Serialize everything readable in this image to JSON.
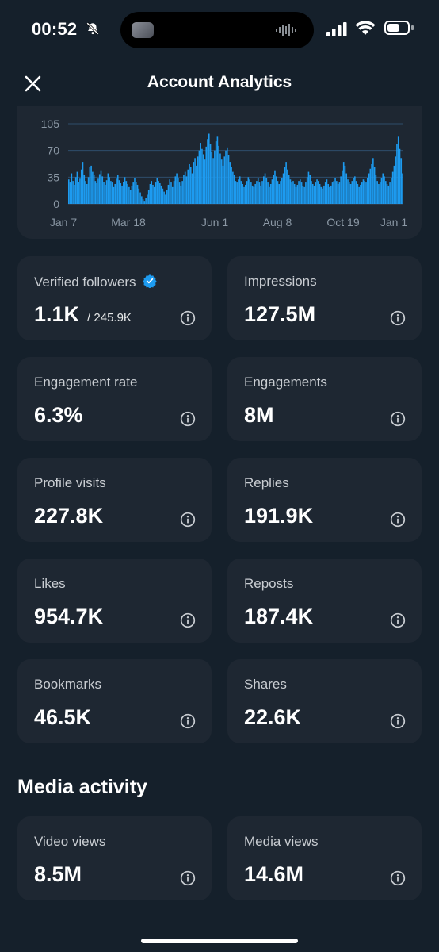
{
  "status_bar": {
    "time": "00:52"
  },
  "header": {
    "title": "Account Analytics"
  },
  "chart_data": {
    "type": "bar",
    "yticks": [
      105,
      70,
      35,
      0
    ],
    "ylim": [
      0,
      105
    ],
    "xticks": [
      "Jan 7",
      "Mar 18",
      "Jun 1",
      "Aug 8",
      "Oct 19",
      "Jan 1"
    ],
    "grid": true,
    "color": "#1d9bf0",
    "values": [
      32,
      28,
      40,
      30,
      25,
      35,
      42,
      29,
      33,
      45,
      55,
      38,
      30,
      26,
      35,
      48,
      50,
      42,
      38,
      30,
      27,
      33,
      39,
      44,
      36,
      29,
      25,
      31,
      40,
      35,
      30,
      28,
      22,
      26,
      33,
      38,
      31,
      27,
      24,
      29,
      35,
      30,
      26,
      22,
      18,
      24,
      28,
      34,
      29,
      25,
      20,
      15,
      10,
      6,
      4,
      8,
      12,
      18,
      26,
      30,
      25,
      22,
      28,
      34,
      30,
      27,
      24,
      20,
      16,
      12,
      18,
      25,
      32,
      28,
      22,
      30,
      36,
      40,
      34,
      28,
      24,
      30,
      38,
      42,
      36,
      45,
      52,
      48,
      40,
      55,
      60,
      50,
      62,
      70,
      80,
      72,
      65,
      58,
      75,
      85,
      92,
      78,
      68,
      60,
      70,
      82,
      88,
      76,
      66,
      58,
      50,
      62,
      70,
      74,
      64,
      55,
      48,
      42,
      38,
      30,
      28,
      32,
      36,
      30,
      26,
      22,
      25,
      30,
      35,
      32,
      28,
      24,
      22,
      26,
      30,
      34,
      28,
      24,
      30,
      36,
      40,
      34,
      28,
      22,
      26,
      32,
      38,
      44,
      36,
      30,
      26,
      30,
      34,
      40,
      48,
      55,
      45,
      38,
      32,
      28,
      30,
      26,
      22,
      25,
      30,
      32,
      28,
      24,
      22,
      28,
      35,
      42,
      38,
      30,
      26,
      24,
      28,
      32,
      30,
      26,
      22,
      20,
      24,
      28,
      32,
      26,
      22,
      24,
      28,
      30,
      34,
      30,
      26,
      28,
      36,
      44,
      55,
      50,
      40,
      32,
      28,
      26,
      30,
      34,
      36,
      30,
      26,
      22,
      25,
      28,
      32,
      30,
      28,
      34,
      40,
      46,
      52,
      60,
      48,
      38,
      30,
      26,
      28,
      34,
      40,
      36,
      30,
      26,
      24,
      28,
      34,
      42,
      50,
      62,
      78,
      88,
      72,
      60,
      40
    ]
  },
  "metrics": [
    {
      "label": "Verified followers",
      "value": "1.1K",
      "sub": "/ 245.9K"
    },
    {
      "label": "Impressions",
      "value": "127.5M"
    },
    {
      "label": "Engagement rate",
      "value": "6.3%"
    },
    {
      "label": "Engagements",
      "value": "8M"
    },
    {
      "label": "Profile visits",
      "value": "227.8K"
    },
    {
      "label": "Replies",
      "value": "191.9K"
    },
    {
      "label": "Likes",
      "value": "954.7K"
    },
    {
      "label": "Reposts",
      "value": "187.4K"
    },
    {
      "label": "Bookmarks",
      "value": "46.5K"
    },
    {
      "label": "Shares",
      "value": "22.6K"
    }
  ],
  "media_section": {
    "title": "Media activity",
    "metrics": [
      {
        "label": "Video views",
        "value": "8.5M"
      },
      {
        "label": "Media views",
        "value": "14.6M"
      }
    ]
  },
  "icons": {
    "close": "close-icon",
    "verified": "verified-badge-icon",
    "info": "info-icon",
    "mute": "bell-slash-icon",
    "signal": "cellular-signal-icon",
    "wifi": "wifi-icon",
    "battery": "battery-icon"
  },
  "colors": {
    "background": "#15202b",
    "card": "#1e2732",
    "accent": "#1d9bf0"
  }
}
